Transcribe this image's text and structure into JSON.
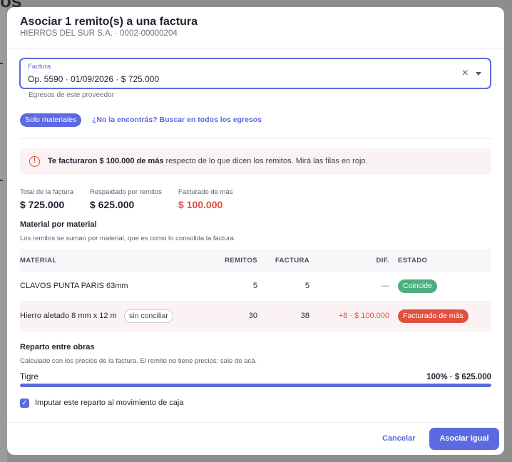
{
  "backdrop": {
    "fragment": "os"
  },
  "modal": {
    "title": "Asociar 1 remito(s) a una factura",
    "subtitle": "HIERROS DEL SUR S.A. · 0002-00000204"
  },
  "factura_select": {
    "label": "Factura",
    "value": "Op. 5590 · 01/09/2026 · $ 725.000",
    "clear_icon": "×",
    "helper": "Egresos de este proveedor"
  },
  "filters": {
    "solo_materiales": "Solo materiales",
    "buscar_link": "¿No la encontrás? Buscar en todos los egresos"
  },
  "alert": {
    "icon": "!",
    "bold": "Te facturaron $ 100.000 de más",
    "rest": " respecto de lo que dicen los remitos. Mirá las filas en rojo."
  },
  "summary": {
    "total_label": "Total de la factura",
    "total_value": "$ 725.000",
    "respaldado_label": "Respaldado por remitos",
    "respaldado_value": "$ 625.000",
    "facturado_label": "Facturado de más",
    "facturado_value": "$ 100.000"
  },
  "material_section": {
    "title": "Material por material",
    "desc": "Los remitos se suman por material, que es como lo consolida la factura."
  },
  "table": {
    "headers": {
      "material": "MATERIAL",
      "remitos": "REMITOS",
      "factura": "FACTURA",
      "dif": "DIF.",
      "estado": "ESTADO"
    },
    "rows": [
      {
        "material": "CLAVOS PUNTA PARIS 63mm",
        "remitos": "5",
        "factura": "5",
        "dif": "—",
        "estado": "Coincide"
      },
      {
        "material": "Hierro aletado 8 mm x 12 m",
        "tag": "sin conciliar",
        "remitos": "30",
        "factura": "38",
        "dif": "+8 · $ 100.000",
        "estado": "Facturado de más"
      }
    ]
  },
  "reparto": {
    "title": "Reparto entre obras",
    "desc": "Calculado con los precios de la factura. El remito no tiene precios: sale de acá.",
    "obras": [
      {
        "name": "Tigre",
        "value": "100% · $ 625.000",
        "fraction": 1.0
      }
    ]
  },
  "imputar": {
    "checked": true,
    "label": "Imputar este reparto al movimiento de caja"
  },
  "footer": {
    "cancel": "Cancelar",
    "primary": "Asociar igual"
  },
  "colors": {
    "accent": "#5b6ae0",
    "danger": "#e0503f",
    "success": "#4caf7c"
  }
}
